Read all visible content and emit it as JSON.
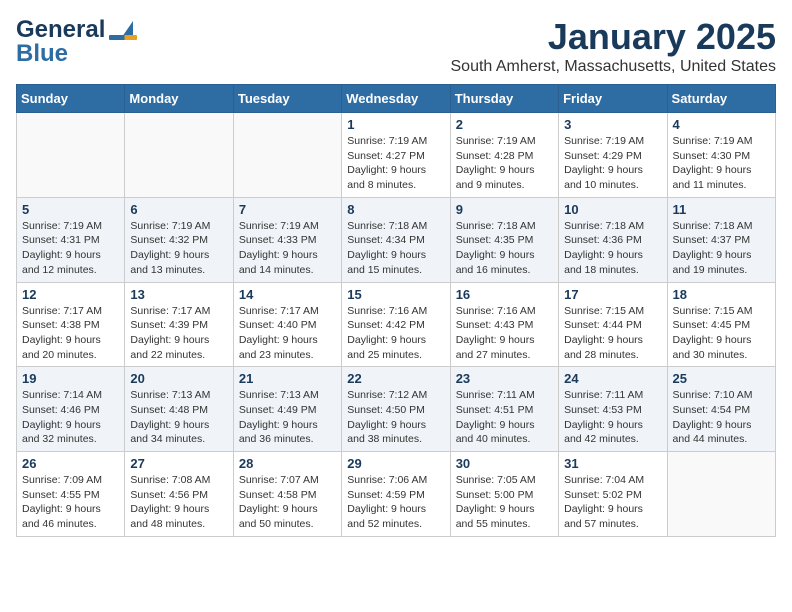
{
  "header": {
    "logo_line1": "General",
    "logo_line2": "Blue",
    "month_year": "January 2025",
    "location": "South Amherst, Massachusetts, United States"
  },
  "weekdays": [
    "Sunday",
    "Monday",
    "Tuesday",
    "Wednesday",
    "Thursday",
    "Friday",
    "Saturday"
  ],
  "weeks": [
    [
      {
        "day": "",
        "info": ""
      },
      {
        "day": "",
        "info": ""
      },
      {
        "day": "",
        "info": ""
      },
      {
        "day": "1",
        "info": "Sunrise: 7:19 AM\nSunset: 4:27 PM\nDaylight: 9 hours and 8 minutes."
      },
      {
        "day": "2",
        "info": "Sunrise: 7:19 AM\nSunset: 4:28 PM\nDaylight: 9 hours and 9 minutes."
      },
      {
        "day": "3",
        "info": "Sunrise: 7:19 AM\nSunset: 4:29 PM\nDaylight: 9 hours and 10 minutes."
      },
      {
        "day": "4",
        "info": "Sunrise: 7:19 AM\nSunset: 4:30 PM\nDaylight: 9 hours and 11 minutes."
      }
    ],
    [
      {
        "day": "5",
        "info": "Sunrise: 7:19 AM\nSunset: 4:31 PM\nDaylight: 9 hours and 12 minutes."
      },
      {
        "day": "6",
        "info": "Sunrise: 7:19 AM\nSunset: 4:32 PM\nDaylight: 9 hours and 13 minutes."
      },
      {
        "day": "7",
        "info": "Sunrise: 7:19 AM\nSunset: 4:33 PM\nDaylight: 9 hours and 14 minutes."
      },
      {
        "day": "8",
        "info": "Sunrise: 7:18 AM\nSunset: 4:34 PM\nDaylight: 9 hours and 15 minutes."
      },
      {
        "day": "9",
        "info": "Sunrise: 7:18 AM\nSunset: 4:35 PM\nDaylight: 9 hours and 16 minutes."
      },
      {
        "day": "10",
        "info": "Sunrise: 7:18 AM\nSunset: 4:36 PM\nDaylight: 9 hours and 18 minutes."
      },
      {
        "day": "11",
        "info": "Sunrise: 7:18 AM\nSunset: 4:37 PM\nDaylight: 9 hours and 19 minutes."
      }
    ],
    [
      {
        "day": "12",
        "info": "Sunrise: 7:17 AM\nSunset: 4:38 PM\nDaylight: 9 hours and 20 minutes."
      },
      {
        "day": "13",
        "info": "Sunrise: 7:17 AM\nSunset: 4:39 PM\nDaylight: 9 hours and 22 minutes."
      },
      {
        "day": "14",
        "info": "Sunrise: 7:17 AM\nSunset: 4:40 PM\nDaylight: 9 hours and 23 minutes."
      },
      {
        "day": "15",
        "info": "Sunrise: 7:16 AM\nSunset: 4:42 PM\nDaylight: 9 hours and 25 minutes."
      },
      {
        "day": "16",
        "info": "Sunrise: 7:16 AM\nSunset: 4:43 PM\nDaylight: 9 hours and 27 minutes."
      },
      {
        "day": "17",
        "info": "Sunrise: 7:15 AM\nSunset: 4:44 PM\nDaylight: 9 hours and 28 minutes."
      },
      {
        "day": "18",
        "info": "Sunrise: 7:15 AM\nSunset: 4:45 PM\nDaylight: 9 hours and 30 minutes."
      }
    ],
    [
      {
        "day": "19",
        "info": "Sunrise: 7:14 AM\nSunset: 4:46 PM\nDaylight: 9 hours and 32 minutes."
      },
      {
        "day": "20",
        "info": "Sunrise: 7:13 AM\nSunset: 4:48 PM\nDaylight: 9 hours and 34 minutes."
      },
      {
        "day": "21",
        "info": "Sunrise: 7:13 AM\nSunset: 4:49 PM\nDaylight: 9 hours and 36 minutes."
      },
      {
        "day": "22",
        "info": "Sunrise: 7:12 AM\nSunset: 4:50 PM\nDaylight: 9 hours and 38 minutes."
      },
      {
        "day": "23",
        "info": "Sunrise: 7:11 AM\nSunset: 4:51 PM\nDaylight: 9 hours and 40 minutes."
      },
      {
        "day": "24",
        "info": "Sunrise: 7:11 AM\nSunset: 4:53 PM\nDaylight: 9 hours and 42 minutes."
      },
      {
        "day": "25",
        "info": "Sunrise: 7:10 AM\nSunset: 4:54 PM\nDaylight: 9 hours and 44 minutes."
      }
    ],
    [
      {
        "day": "26",
        "info": "Sunrise: 7:09 AM\nSunset: 4:55 PM\nDaylight: 9 hours and 46 minutes."
      },
      {
        "day": "27",
        "info": "Sunrise: 7:08 AM\nSunset: 4:56 PM\nDaylight: 9 hours and 48 minutes."
      },
      {
        "day": "28",
        "info": "Sunrise: 7:07 AM\nSunset: 4:58 PM\nDaylight: 9 hours and 50 minutes."
      },
      {
        "day": "29",
        "info": "Sunrise: 7:06 AM\nSunset: 4:59 PM\nDaylight: 9 hours and 52 minutes."
      },
      {
        "day": "30",
        "info": "Sunrise: 7:05 AM\nSunset: 5:00 PM\nDaylight: 9 hours and 55 minutes."
      },
      {
        "day": "31",
        "info": "Sunrise: 7:04 AM\nSunset: 5:02 PM\nDaylight: 9 hours and 57 minutes."
      },
      {
        "day": "",
        "info": ""
      }
    ]
  ]
}
